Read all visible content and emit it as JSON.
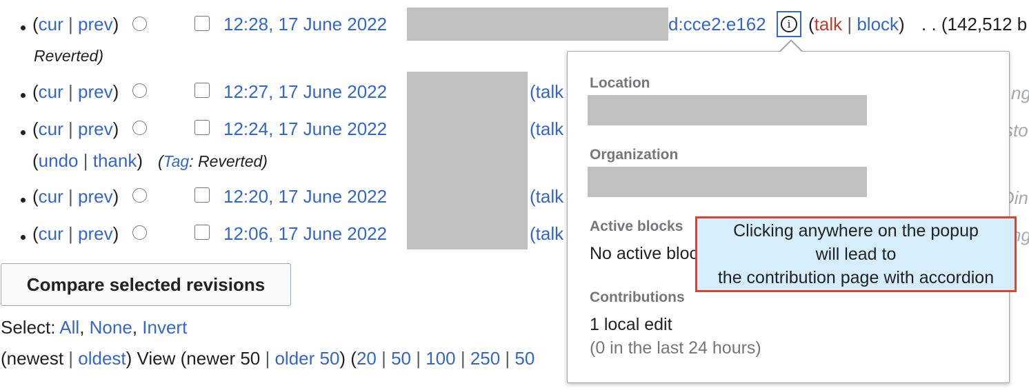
{
  "rows": [
    {
      "cur": "cur",
      "prev": "prev",
      "date": "12:28, 17 June 2022",
      "user_suffix": "d:cce2:e162",
      "talk": "talk",
      "block": "block",
      "size": ". . (142,512 b",
      "tag_label": "Reverted)"
    },
    {
      "cur": "cur",
      "prev": "prev",
      "date": "12:27, 17 June 2022",
      "talk": "(talk",
      "tail": "ng"
    },
    {
      "cur": "cur",
      "prev": "prev",
      "date": "12:24, 17 June 2022",
      "talk": "(talk",
      "tail": "sto",
      "undo": "undo",
      "thank": "thank",
      "tag": "Tag",
      "tag_value": ": Reverted)"
    },
    {
      "cur": "cur",
      "prev": "prev",
      "date": "12:20, 17 June 2022",
      "talk": "(talk",
      "tail": "Din"
    },
    {
      "cur": "cur",
      "prev": "prev",
      "date": "12:06, 17 June 2022",
      "talk": "(talk",
      "tail": "ng"
    }
  ],
  "compare_button": "Compare selected revisions",
  "select": {
    "label": "Select:",
    "all": "All",
    "none": "None",
    "invert": "Invert"
  },
  "nav": {
    "newest": "(newest",
    "oldest": "oldest",
    "view": ") View (newer 50",
    "older": "older 50",
    "n20": "20",
    "n50": "50",
    "n100": "100",
    "n250": "250",
    "n500": "50"
  },
  "popup": {
    "location_label": "Location",
    "organization_label": "Organization",
    "blocks_label": "Active blocks",
    "blocks_value": "No active blocks",
    "contributions_label": "Contributions",
    "contributions_value": "1 local edit",
    "contributions_sub": "(0 in the last 24 hours)"
  },
  "tooltip": {
    "line1": "Clicking anywhere on the popup",
    "line2": "will lead to",
    "line3": "the contribution page with accordion"
  },
  "icons": {
    "info": "info-icon",
    "radio": "radio-button",
    "checkbox": "checkbox"
  },
  "colors": {
    "link": "#3366cc",
    "redlink": "#bf3c2c",
    "tooltip_border": "#d9432f",
    "tooltip_bg": "#d6eefc",
    "highlight": "#3366cc"
  }
}
